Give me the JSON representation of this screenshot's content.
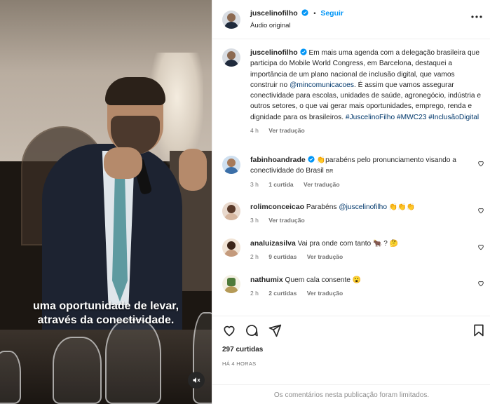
{
  "video": {
    "caption_line1": "uma oportunidade de levar,",
    "caption_line2": "através da conectividade."
  },
  "header": {
    "username": "juscelinofilho",
    "separator": "•",
    "follow_label": "Seguir",
    "audio": "Áudio original"
  },
  "post": {
    "username": "juscelinofilho",
    "text_before_mention": "Em mais uma agenda com a delegação brasileira que participa do Mobile World Congress, em Barcelona, destaquei a importância de um plano nacional de inclusão digital, que vamos construir no ",
    "mention": "@mincomunicacoes",
    "text_after_mention": ". É assim que vamos assegurar conectividade para escolas, unidades de saúde, agronegócio, indústria e outros setores, o que vai gerar mais oportunidades, emprego, renda e dignidade para os brasileiros. ",
    "hashtags": "#JuscelinoFilho #MWC23 #InclusãoDigital",
    "time": "4 h",
    "see_translation": "Ver tradução"
  },
  "comments": [
    {
      "username": "fabinhoandrade",
      "emoji_prefix": "👏",
      "text": "parabéns pelo pronunciamento visando a conectividade do Brasil",
      "flag": "BR",
      "time": "3 h",
      "likes": "1 curtida",
      "see_translation": "Ver tradução"
    },
    {
      "username": "rolimconceicao",
      "text": "Parabéns ",
      "mention": "@juscelinofilho",
      "emoji_suffix": " 👏👏👏",
      "time": "3 h",
      "see_translation": "Ver tradução"
    },
    {
      "username": "analuizasilva",
      "text": "Vai pra onde com tanto ",
      "emoji_suffix": "🐂 ? 🤔",
      "time": "2 h",
      "likes": "9 curtidas",
      "see_translation": "Ver tradução"
    },
    {
      "username": "nathumix",
      "text": "Quem cala consente ",
      "emoji_suffix": "😮",
      "time": "2 h",
      "likes": "2 curtidas",
      "see_translation": "Ver tradução"
    }
  ],
  "footer": {
    "likes": "297 curtidas",
    "posted": "HÁ 4 HORAS",
    "limited": "Os comentários nesta publicação foram limitados."
  },
  "colors": {
    "link": "#00376b",
    "follow": "#0095f6",
    "verified": "#0095f6",
    "muted": "#737373"
  },
  "icons": [
    "verified-icon",
    "heart-icon",
    "comment-icon",
    "share-icon",
    "bookmark-icon",
    "mute-icon",
    "more-icon"
  ]
}
